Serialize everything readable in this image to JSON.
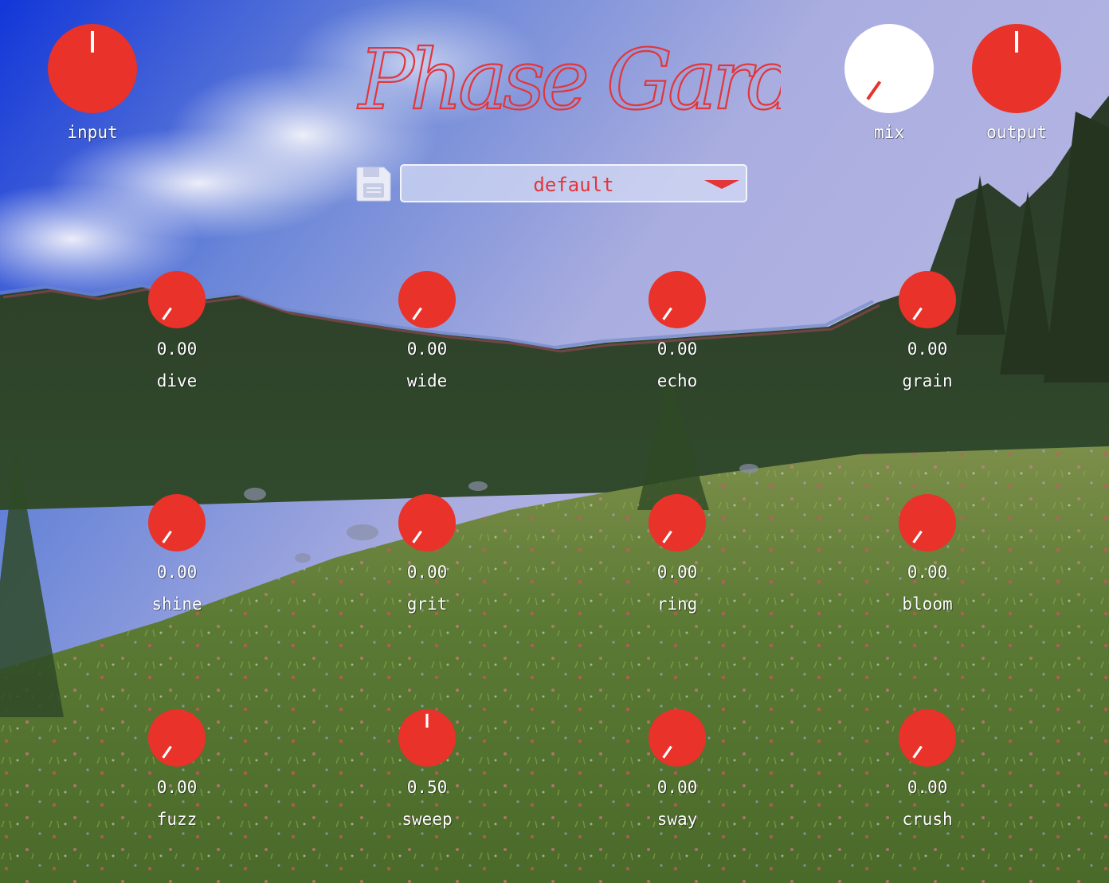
{
  "app": {
    "title": "Phase Garden"
  },
  "colors": {
    "knob": "#e8322a",
    "mix_knob": "#ffffff",
    "accent": "#e3353a",
    "label": "#ffffff"
  },
  "preset": {
    "selected": "default",
    "save_icon": "floppy-disk-icon",
    "dropdown_icon": "caret-down-icon"
  },
  "main_knobs": {
    "input": {
      "label": "input",
      "value_fraction": 0.5
    },
    "mix": {
      "label": "mix",
      "value_fraction": 0.0
    },
    "output": {
      "label": "output",
      "value_fraction": 0.5
    }
  },
  "knobs": [
    {
      "name": "dive",
      "value": "0.00",
      "value_fraction": 0.0
    },
    {
      "name": "wide",
      "value": "0.00",
      "value_fraction": 0.0
    },
    {
      "name": "echo",
      "value": "0.00",
      "value_fraction": 0.0
    },
    {
      "name": "grain",
      "value": "0.00",
      "value_fraction": 0.0
    },
    {
      "name": "shine",
      "value": "0.00",
      "value_fraction": 0.0
    },
    {
      "name": "grit",
      "value": "0.00",
      "value_fraction": 0.0
    },
    {
      "name": "ring",
      "value": "0.00",
      "value_fraction": 0.0
    },
    {
      "name": "bloom",
      "value": "0.00",
      "value_fraction": 0.0
    },
    {
      "name": "fuzz",
      "value": "0.00",
      "value_fraction": 0.0
    },
    {
      "name": "sweep",
      "value": "0.50",
      "value_fraction": 0.5
    },
    {
      "name": "sway",
      "value": "0.00",
      "value_fraction": 0.0
    },
    {
      "name": "crush",
      "value": "0.00",
      "value_fraction": 0.0
    }
  ]
}
